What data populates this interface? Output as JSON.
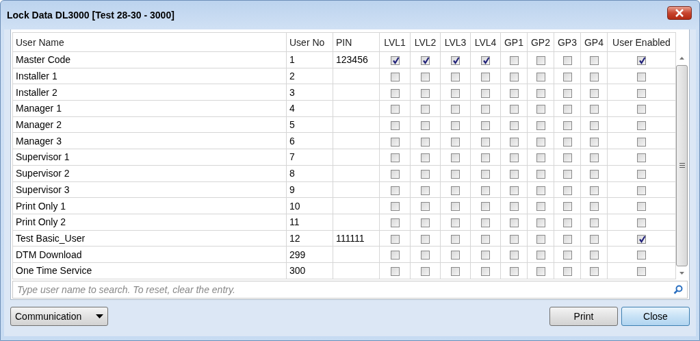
{
  "window": {
    "title": "Lock Data DL3000 [Test 28-30 - 3000]"
  },
  "table": {
    "columns": [
      "User Name",
      "User No",
      "PIN",
      "LVL1",
      "LVL2",
      "LVL3",
      "LVL4",
      "GP1",
      "GP2",
      "GP3",
      "GP4",
      "User Enabled"
    ],
    "rows": [
      {
        "name": "Master Code",
        "user_no": "1",
        "pin": "123456",
        "checks": [
          true,
          true,
          true,
          true,
          false,
          false,
          false,
          false,
          true
        ]
      },
      {
        "name": "Installer 1",
        "user_no": "2",
        "checks": [
          false,
          false,
          false,
          false,
          false,
          false,
          false,
          false,
          false
        ]
      },
      {
        "name": "Installer 2",
        "user_no": "3",
        "checks": [
          false,
          false,
          false,
          false,
          false,
          false,
          false,
          false,
          false
        ]
      },
      {
        "name": "Manager 1",
        "user_no": "4",
        "checks": [
          false,
          false,
          false,
          false,
          false,
          false,
          false,
          false,
          false
        ]
      },
      {
        "name": "Manager 2",
        "user_no": "5",
        "checks": [
          false,
          false,
          false,
          false,
          false,
          false,
          false,
          false,
          false
        ]
      },
      {
        "name": "Manager 3",
        "user_no": "6",
        "checks": [
          false,
          false,
          false,
          false,
          false,
          false,
          false,
          false,
          false
        ]
      },
      {
        "name": "Supervisor 1",
        "user_no": "7",
        "checks": [
          false,
          false,
          false,
          false,
          false,
          false,
          false,
          false,
          false
        ]
      },
      {
        "name": "Supervisor 2",
        "user_no": "8",
        "checks": [
          false,
          false,
          false,
          false,
          false,
          false,
          false,
          false,
          false
        ]
      },
      {
        "name": "Supervisor 3",
        "user_no": "9",
        "checks": [
          false,
          false,
          false,
          false,
          false,
          false,
          false,
          false,
          false
        ]
      },
      {
        "name": "Print Only 1",
        "user_no": "10",
        "checks": [
          false,
          false,
          false,
          false,
          false,
          false,
          false,
          false,
          false
        ]
      },
      {
        "name": "Print Only 2",
        "user_no": "11",
        "checks": [
          false,
          false,
          false,
          false,
          false,
          false,
          false,
          false,
          false
        ]
      },
      {
        "name": "Test Basic_User",
        "user_no": "12",
        "pin": "111111",
        "checks": [
          false,
          false,
          false,
          false,
          false,
          false,
          false,
          false,
          true
        ]
      },
      {
        "name": "DTM Download",
        "user_no": "299",
        "checks": [
          false,
          false,
          false,
          false,
          false,
          false,
          false,
          false,
          false
        ]
      },
      {
        "name": "One Time Service",
        "user_no": "300",
        "checks": [
          false,
          false,
          false,
          false,
          false,
          false,
          false,
          false,
          false
        ]
      }
    ]
  },
  "search": {
    "placeholder": "Type user name to search. To reset, clear the entry."
  },
  "footer": {
    "dropdown": "Communication",
    "buttons": [
      "Print",
      "Close"
    ]
  }
}
